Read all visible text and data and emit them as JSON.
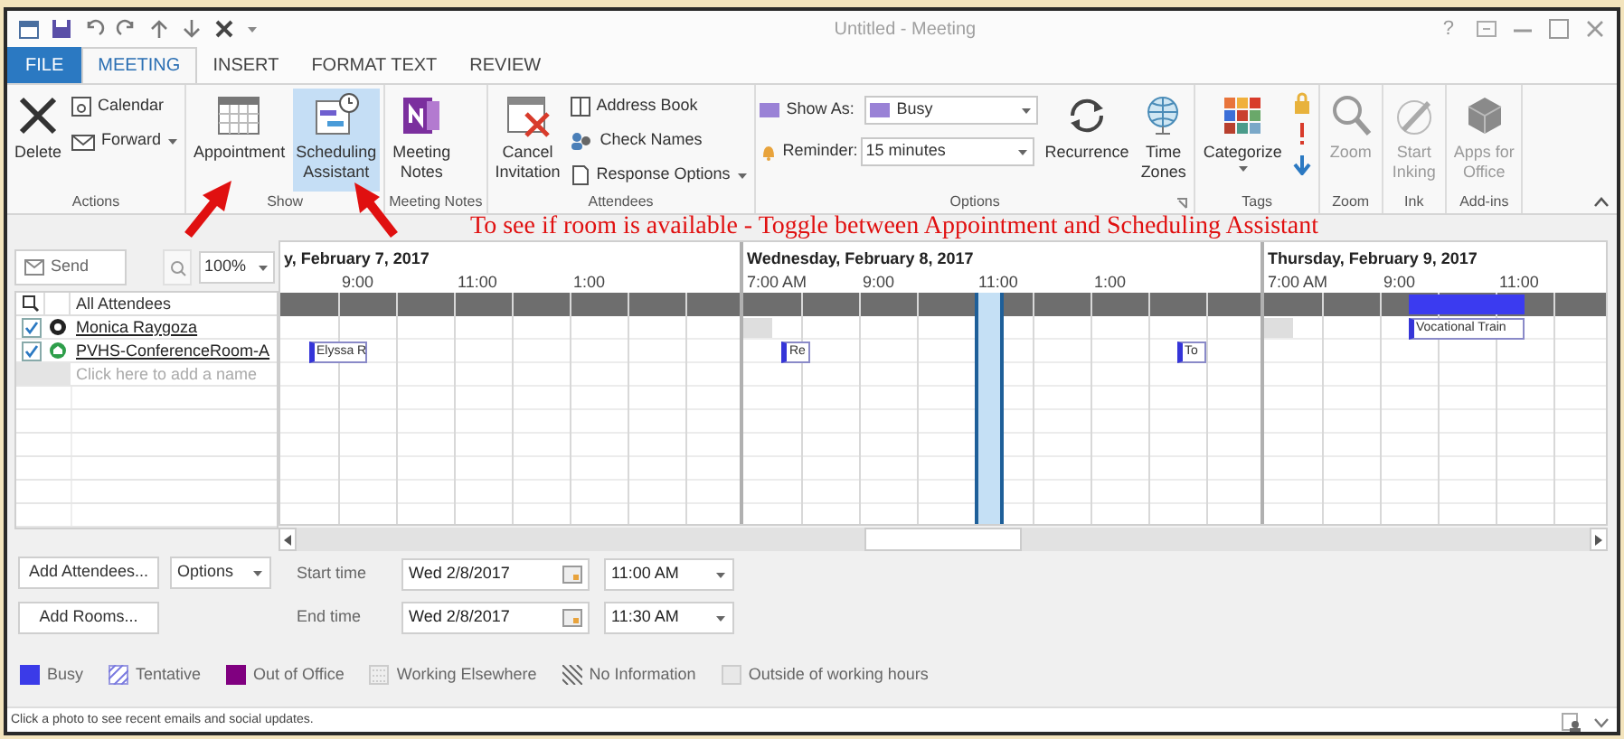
{
  "window": {
    "title": "Untitled - Meeting",
    "help": "?"
  },
  "tabs": [
    {
      "label": "FILE",
      "kind": "backstage",
      "selected": false
    },
    {
      "label": "MEETING",
      "kind": "tab",
      "selected": true
    },
    {
      "label": "INSERT",
      "kind": "tab",
      "selected": false
    },
    {
      "label": "FORMAT TEXT",
      "kind": "tab",
      "selected": false
    },
    {
      "label": "REVIEW",
      "kind": "tab",
      "selected": false
    }
  ],
  "ribbon": {
    "groups": [
      {
        "label": "Actions",
        "kind": "plain",
        "items": [
          {
            "label": "Delete",
            "kind": "large",
            "disabled": false,
            "dropdown": false
          },
          {
            "label": "Calendar",
            "kind": "small",
            "disabled": false,
            "dropdown": false
          },
          {
            "label": "Forward",
            "kind": "small",
            "disabled": false,
            "dropdown": true
          }
        ]
      },
      {
        "label": "Show",
        "kind": "plain",
        "items": [
          {
            "label": "Appointment",
            "kind": "large",
            "disabled": false,
            "dropdown": false,
            "selected": false
          },
          {
            "label": "Scheduling\nAssistant",
            "kind": "large",
            "disabled": false,
            "dropdown": false,
            "selected": true
          }
        ]
      },
      {
        "label": "Meeting Notes",
        "kind": "plain",
        "items": [
          {
            "label": "Meeting\nNotes",
            "kind": "large",
            "disabled": false,
            "dropdown": false
          }
        ]
      },
      {
        "label": "Attendees",
        "kind": "plain",
        "items": [
          {
            "label": "Cancel\nInvitation",
            "kind": "large",
            "disabled": false,
            "dropdown": false
          },
          {
            "label": "Address Book",
            "kind": "small",
            "disabled": false,
            "dropdown": false
          },
          {
            "label": "Check Names",
            "kind": "small",
            "disabled": false,
            "dropdown": false
          },
          {
            "label": "Response Options",
            "kind": "small",
            "disabled": false,
            "dropdown": true
          }
        ]
      },
      {
        "label": "Options",
        "kind": "launcher",
        "items": [
          {
            "label": "Show As:",
            "value": "Busy",
            "kind": "field",
            "disabled": false,
            "dropdown": true
          },
          {
            "label": "Reminder:",
            "value": "15 minutes",
            "kind": "field",
            "disabled": false,
            "dropdown": true
          },
          {
            "label": "Recurrence",
            "kind": "large",
            "disabled": false,
            "dropdown": false
          },
          {
            "label": "Time\nZones",
            "kind": "large",
            "disabled": false,
            "dropdown": false
          }
        ]
      },
      {
        "label": "Tags",
        "kind": "tags",
        "items": [
          {
            "label": "Categorize",
            "kind": "large",
            "disabled": false,
            "dropdown": true
          }
        ]
      },
      {
        "label": "Zoom",
        "kind": "plain",
        "items": [
          {
            "label": "Zoom",
            "kind": "large",
            "disabled": true,
            "dropdown": false
          }
        ]
      },
      {
        "label": "Ink",
        "kind": "plain",
        "items": [
          {
            "label": "Start\nInking",
            "kind": "large",
            "disabled": true,
            "dropdown": false
          }
        ]
      },
      {
        "label": "Add-ins",
        "kind": "plain",
        "items": [
          {
            "label": "Apps for\nOffice",
            "kind": "large",
            "disabled": true,
            "dropdown": false
          }
        ]
      }
    ]
  },
  "annotation": {
    "text": "To see if room is available - Toggle between Appointment and Scheduling Assistant"
  },
  "scheduler": {
    "send": "Send",
    "zoom": "100%",
    "attendees_header": "All Attendees",
    "attendees": [
      {
        "name": "Monica Raygoza",
        "kind": "person",
        "checked": true
      },
      {
        "name": "PVHS-ConferenceRoom-A",
        "kind": "room",
        "checked": true
      }
    ],
    "add_placeholder": "Click here to add a name",
    "days": [
      {
        "label": "y, February 7, 2017",
        "hours": [
          "9:00",
          "11:00",
          "1:00"
        ],
        "events": [
          {
            "kind": "appointment",
            "text": "Elyssa R"
          }
        ]
      },
      {
        "label": "Wednesday, February 8, 2017",
        "hours": [
          "7:00 AM",
          "9:00",
          "11:00",
          "1:00"
        ],
        "events": [
          {
            "kind": "outside"
          },
          {
            "kind": "appointment",
            "text": "Re"
          },
          {
            "kind": "appointment",
            "text": "To"
          }
        ]
      },
      {
        "label": "Thursday, February 9, 2017",
        "hours": [
          "7:00 AM",
          "9:00",
          "11:00"
        ],
        "events": [
          {
            "kind": "outside"
          },
          {
            "kind": "busy"
          },
          {
            "kind": "appointment",
            "text": "Vocational Train"
          }
        ]
      }
    ]
  },
  "meeting": {
    "add_attendees": "Add Attendees...",
    "options": "Options",
    "add_rooms": "Add Rooms...",
    "start": {
      "label": "Start time",
      "date": "Wed 2/8/2017",
      "time": "11:00 AM"
    },
    "end": {
      "label": "End time",
      "date": "Wed 2/8/2017",
      "time": "11:30 AM"
    }
  },
  "legend": [
    {
      "label": "Busy",
      "kind": "busy"
    },
    {
      "label": "Tentative",
      "kind": "tentative"
    },
    {
      "label": "Out of Office",
      "kind": "oof"
    },
    {
      "label": "Working Elsewhere",
      "kind": "elsewhere"
    },
    {
      "label": "No Information",
      "kind": "noinfo"
    },
    {
      "label": "Outside of working hours",
      "kind": "outside"
    }
  ],
  "status_bar": {
    "text": "Click a photo to see recent emails and social updates."
  }
}
